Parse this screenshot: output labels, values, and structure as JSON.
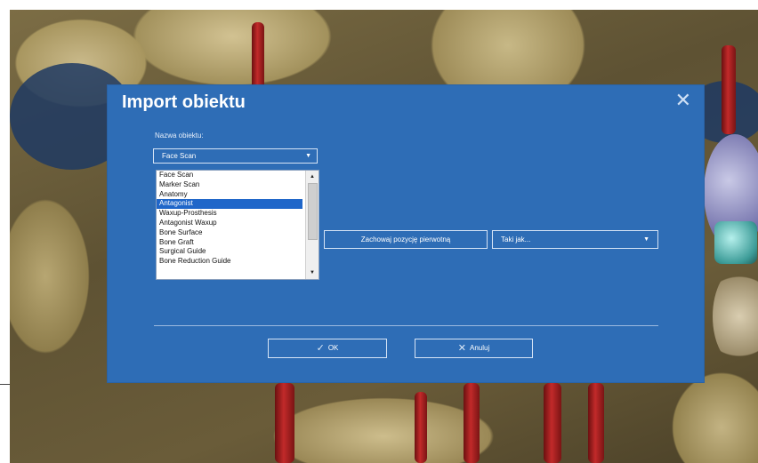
{
  "dialog": {
    "title": "Import obiektu",
    "close_icon": "close-icon",
    "object_name_label": "Nazwa obiektu:",
    "object_combo_value": "Face Scan",
    "list_items": [
      "Face Scan",
      "Marker Scan",
      "Anatomy",
      "Antagonist",
      "Waxup-Prosthesis",
      "Antagonist Waxup",
      "Bone Surface",
      "Bone Graft",
      "Surgical Guide",
      "Bone Reduction Guide"
    ],
    "selected_item": "Antagonist",
    "keep_position_label": "Zachowaj pozycję pierwotną",
    "same_as_value": "Taki jak...",
    "ok_label": "OK",
    "cancel_label": "Anuluj"
  },
  "colors": {
    "dialog_bg": "#2e6db6",
    "selection": "#1f66c9",
    "rod": "#c22a2a"
  }
}
